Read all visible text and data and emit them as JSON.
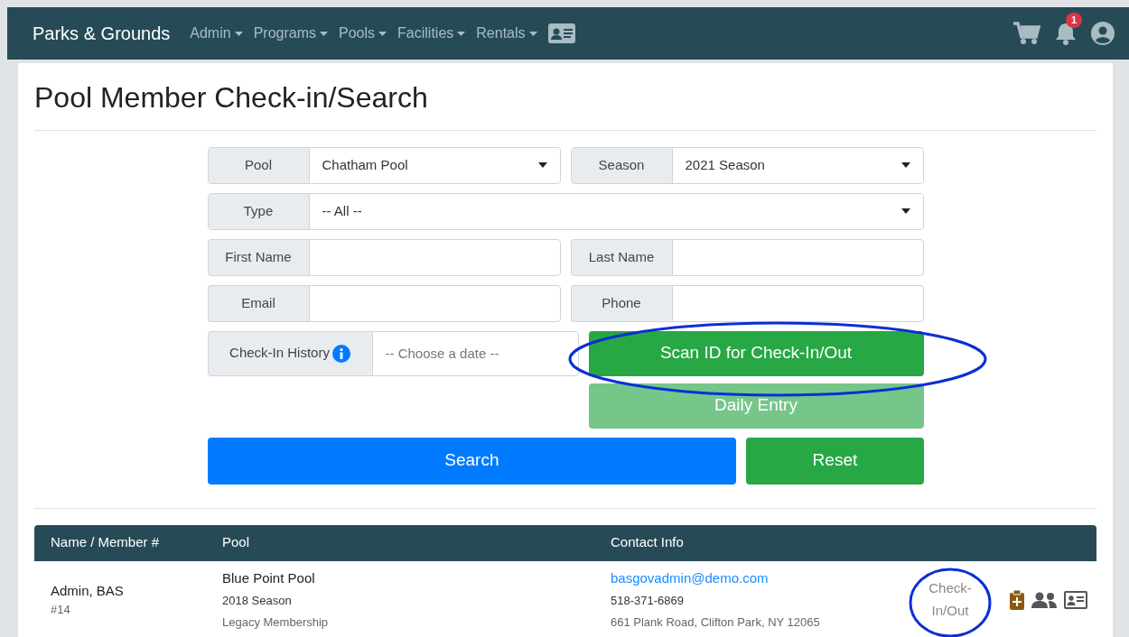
{
  "navbar": {
    "brand": "Parks & Grounds",
    "menus": [
      {
        "label": "Admin"
      },
      {
        "label": "Programs"
      },
      {
        "label": "Pools"
      },
      {
        "label": "Facilities"
      },
      {
        "label": "Rentals"
      }
    ],
    "notification_count": "1"
  },
  "page_title": "Pool Member Check-in/Search",
  "form_rows": [
    [
      {
        "kind": "select",
        "label": "Pool",
        "value": "Chatham Pool"
      },
      {
        "kind": "select",
        "label": "Season",
        "value": "2021 Season"
      }
    ],
    [
      {
        "kind": "select",
        "label": "Type",
        "value": "-- All --"
      }
    ],
    [
      {
        "kind": "text",
        "label": "First Name"
      },
      {
        "kind": "text",
        "label": "Last Name"
      }
    ],
    [
      {
        "kind": "text",
        "label": "Email"
      },
      {
        "kind": "text",
        "label": "Phone"
      }
    ]
  ],
  "history": {
    "label": "Check-In History",
    "info": true,
    "placeholder": "-- Choose a date --"
  },
  "scan_button": {
    "label": "Scan ID for Check-In/Out",
    "circled": true
  },
  "daily_entry_button": {
    "label": "Daily Entry",
    "disabled": true
  },
  "search_button": {
    "label": "Search"
  },
  "reset_button": {
    "label": "Reset"
  },
  "table": {
    "columns": [
      "Name / Member #",
      "Pool",
      "Contact Info"
    ],
    "rows": [
      {
        "name": "Admin, BAS",
        "member_no": "#14",
        "pool": "Blue Point Pool",
        "season": "2018 Season",
        "membership": "Legacy Membership",
        "email": "basgovadmin@demo.com",
        "phone": "518-371-6869",
        "address": "661 Plank Road, Clifton Park, NY 12065",
        "check_link": "Check-In/Out",
        "check_circled": true
      }
    ]
  }
}
